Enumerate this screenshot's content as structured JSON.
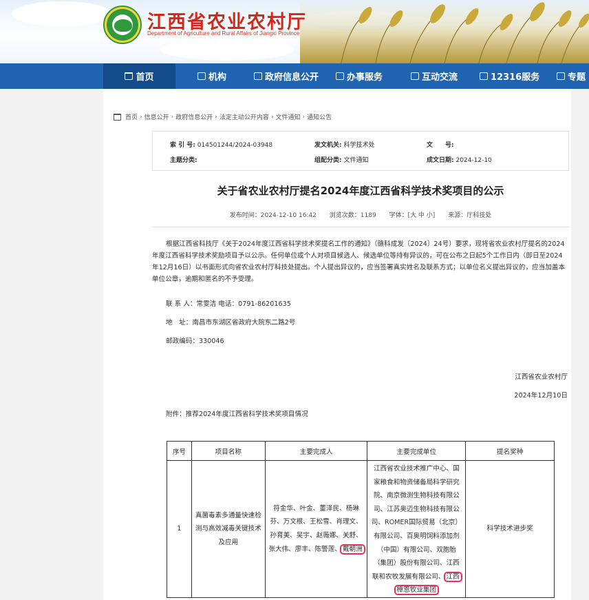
{
  "header": {
    "title": "江西省农业农村厅",
    "subtitle": "Department of Agriculture and Rural Affairs of Jiangxi Province"
  },
  "nav": [
    {
      "label": "首页",
      "icon": "home-icon",
      "active": true
    },
    {
      "label": "机构",
      "icon": "building-icon"
    },
    {
      "label": "政府信息公开",
      "icon": "book-icon"
    },
    {
      "label": "办事服务",
      "icon": "service-icon"
    },
    {
      "label": "互动交流",
      "icon": "chat-icon"
    },
    {
      "label": "12316服务",
      "icon": "phone-icon"
    },
    {
      "label": "专题",
      "icon": "document-icon"
    }
  ],
  "breadcrumb": [
    "首页",
    "信息公开",
    "政府信息公开",
    "法定主动公开内容",
    "文件通知",
    "通知公告"
  ],
  "meta": {
    "index_label": "索 引 号:",
    "index_value": "014501244/2024-03948",
    "issuer_label": "发文机关:",
    "issuer_value": "科学技术处",
    "docno_label": "文　　号:",
    "docno_value": "",
    "topic_label": "主题分类:",
    "topic_value": "",
    "category_label": "组配分类:",
    "category_value": "文件通知",
    "date_label": "成文日期:",
    "date_value": "2024-12-10"
  },
  "article": {
    "title": "关于省农业农村厅提名2024年度江西省科学技术奖项目的公示",
    "publish_time": "发布时间：2024-12-10 16:42",
    "views": "浏览次数：1189",
    "font_size": "字体：[大 中 小]",
    "source": "来源：厅科技处",
    "paragraph": "根据江西省科技厅《关于2024年度江西省科学技术奖提名工作的通知》（赣科成发〔2024〕24号）要求，现将省农业农村厅提名的2024年度江西省科学技术奖励项目予以公示。任何单位或个人对项目候选人、候选单位等持有异议的，可在公布之日起5个工作日内（即日至2024年12月16日）以书面形式向省农业农村厅科技处提出。个人提出异议的，应当签署真实姓名及联系方式；以单位名义提出异议的，应当加盖本单位公章，逾期和匿名的不予受理。",
    "contact": "联 系 人：常雯洁  电话：0791-86201635",
    "address": "地　址：南昌市东湖区省政府大院东二路2号",
    "postcode": "邮政编码：330046",
    "signature": "江西省农业农村厅",
    "sign_date": "2024年12月10日",
    "attachment": "附件：推荐2024年度江西省科学技术奖项目情况"
  },
  "table": {
    "headers": [
      "序号",
      "项目名称",
      "主要完成人",
      "主要完成单位",
      "提名奖种"
    ],
    "rows": [
      {
        "no": "1",
        "project": "真菌毒素多通量快速检测与高效减毒关键技术及应用",
        "people_main": "符金华、叶金、董泽民、杨琳芬、万文根、王松雪、肖理文、孙育美、吴宇、赵薇娜、关舒、张大伟、廖丰、陈警莲、",
        "people_highlight": "戴朝洲",
        "units_main": "江西省农业技术推广中心、国家粮食和物资储备局科学研究院、南京微测生物科技有限公司、江苏奥迈生物科技有限公司、ROMER国际贸易（北京）有限公司、百奥明饲料添加剂（中国）有限公司、双胞胎（集团）股份有限公司、江西联和农牧发展有限公司、",
        "units_highlight_a": "江西",
        "units_highlight_b": "樟恩牧业集团",
        "award": "科学技术进步奖"
      }
    ]
  }
}
